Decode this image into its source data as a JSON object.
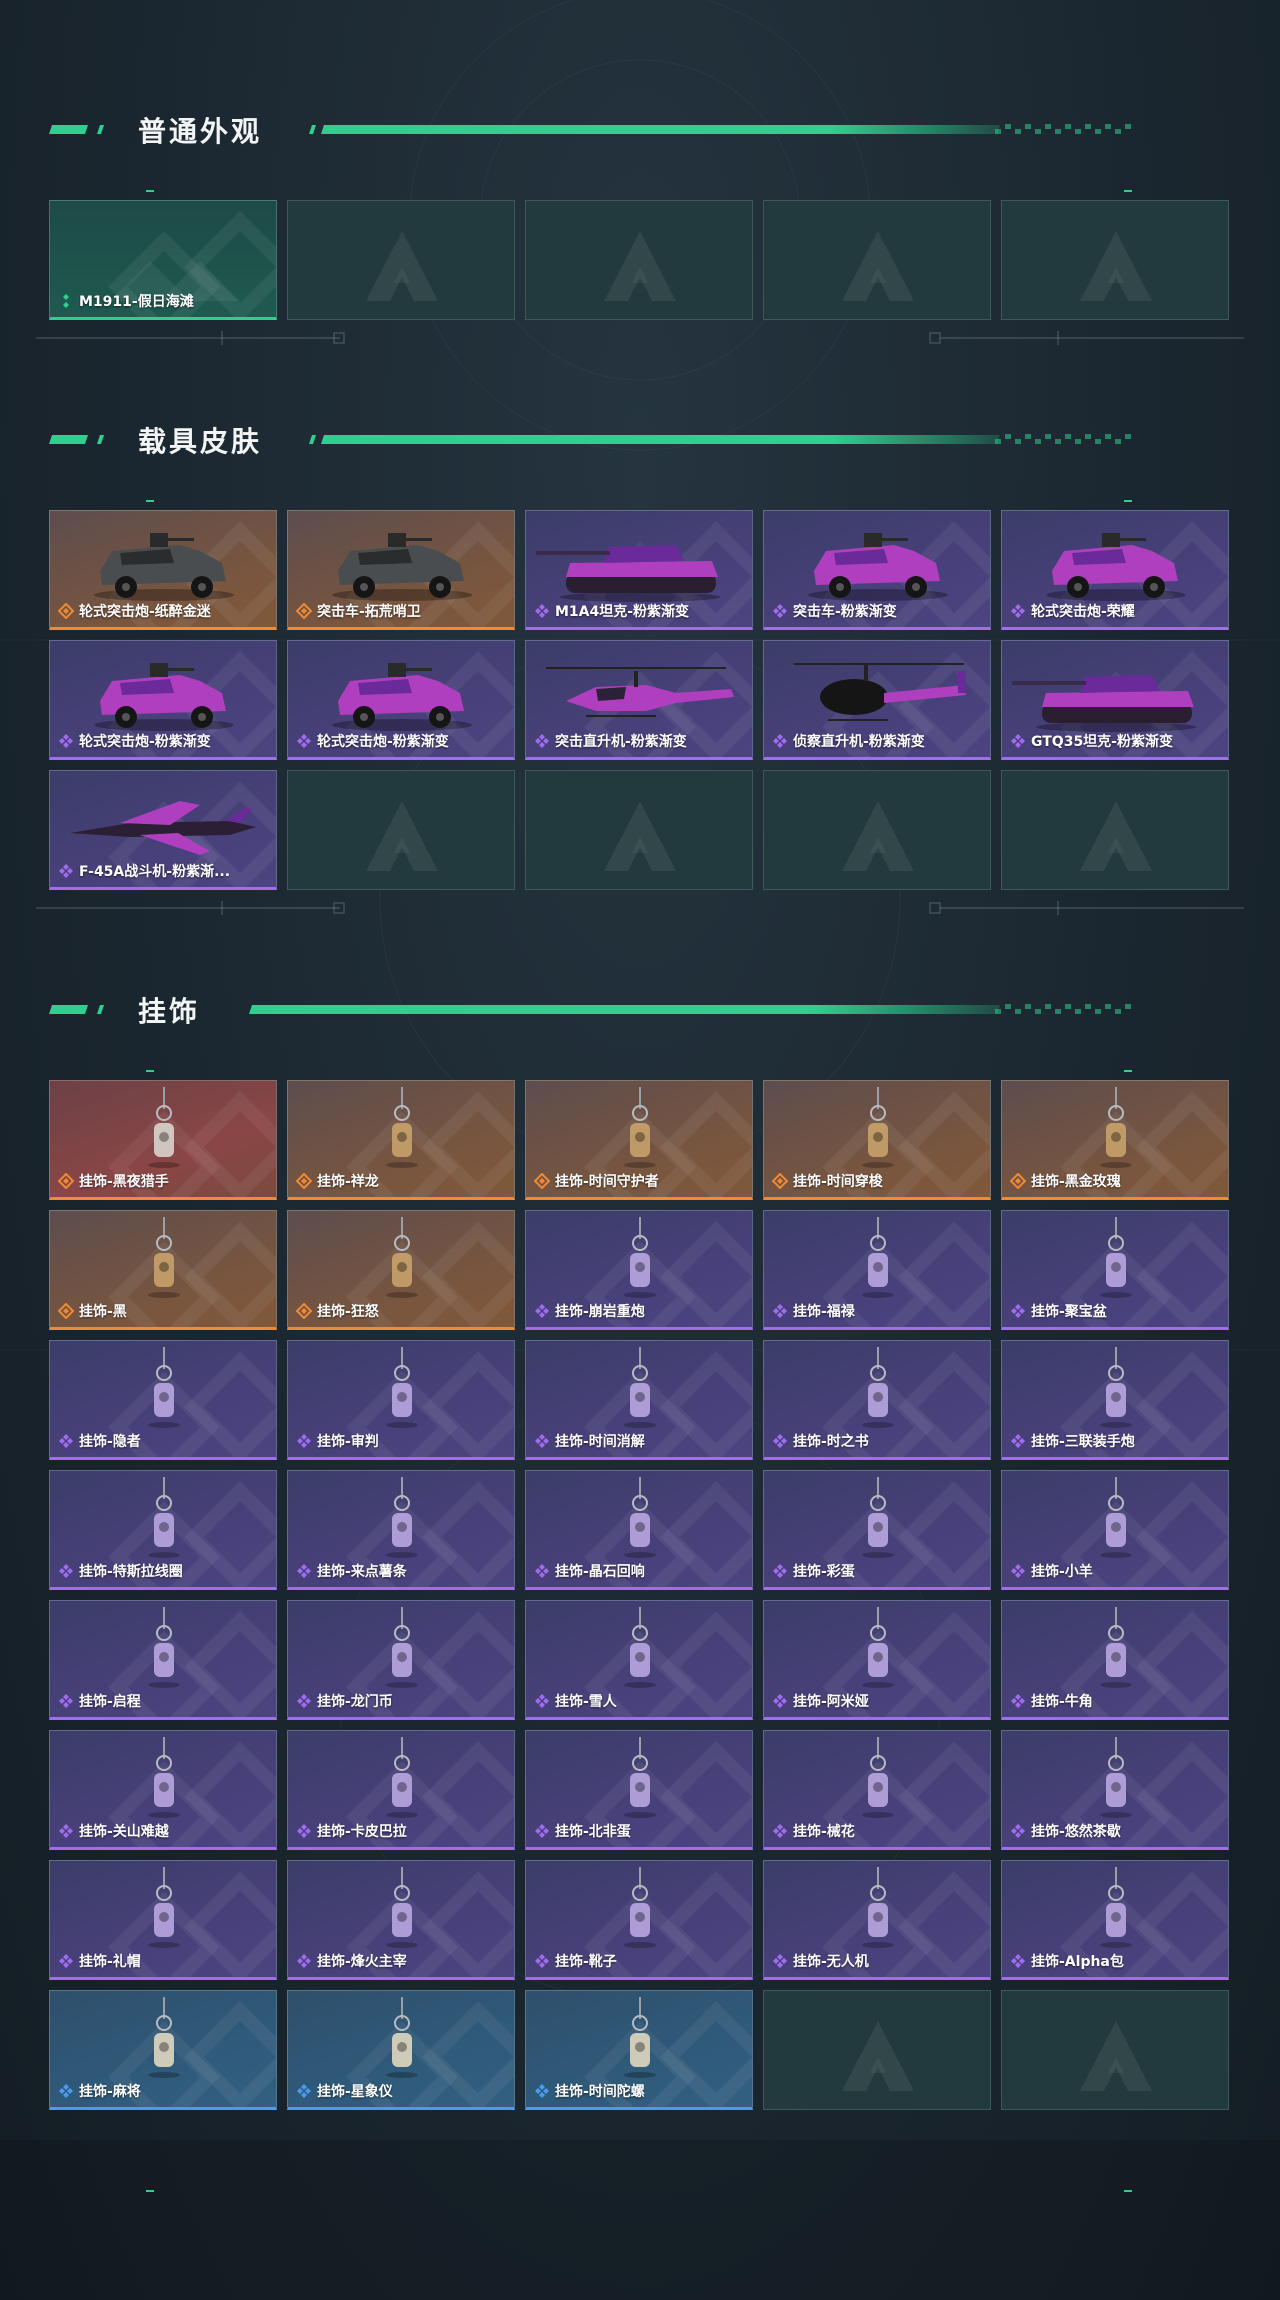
{
  "sections": [
    {
      "title": "普通外观",
      "items": [
        {
          "label": "M1911-假日海滩",
          "rarity": "green",
          "icon": "pistol-skin"
        },
        {
          "label": "",
          "rarity": "empty",
          "icon": "empty-slot"
        },
        {
          "label": "",
          "rarity": "empty",
          "icon": "empty-slot"
        },
        {
          "label": "",
          "rarity": "empty",
          "icon": "empty-slot"
        },
        {
          "label": "",
          "rarity": "empty",
          "icon": "empty-slot"
        }
      ]
    },
    {
      "title": "载具皮肤",
      "items": [
        {
          "label": "轮式突击炮-纸醉金迷",
          "rarity": "orange",
          "icon": "armored-car"
        },
        {
          "label": "突击车-拓荒哨卫",
          "rarity": "orange",
          "icon": "armored-car"
        },
        {
          "label": "M1A4坦克-粉紫渐变",
          "rarity": "purple",
          "icon": "tank"
        },
        {
          "label": "突击车-粉紫渐变",
          "rarity": "purple",
          "icon": "armored-car"
        },
        {
          "label": "轮式突击炮-荣耀",
          "rarity": "purple",
          "icon": "armored-car"
        },
        {
          "label": "轮式突击炮-粉紫渐变",
          "rarity": "purple",
          "icon": "armored-car"
        },
        {
          "label": "轮式突击炮-粉紫渐变",
          "rarity": "purple",
          "icon": "armored-car"
        },
        {
          "label": "突击直升机-粉紫渐变",
          "rarity": "purple",
          "icon": "attack-helicopter"
        },
        {
          "label": "侦察直升机-粉紫渐变",
          "rarity": "purple",
          "icon": "scout-helicopter"
        },
        {
          "label": "GTQ35坦克-粉紫渐变",
          "rarity": "purple",
          "icon": "tank"
        },
        {
          "label": "F-45A战斗机-粉紫渐...",
          "rarity": "purple",
          "icon": "fighter-jet"
        },
        {
          "label": "",
          "rarity": "empty",
          "icon": "empty-slot"
        },
        {
          "label": "",
          "rarity": "empty",
          "icon": "empty-slot"
        },
        {
          "label": "",
          "rarity": "empty",
          "icon": "empty-slot"
        },
        {
          "label": "",
          "rarity": "empty",
          "icon": "empty-slot"
        }
      ]
    },
    {
      "title": "挂饰",
      "items": [
        {
          "label": "挂饰-黑夜猎手",
          "rarity": "red",
          "icon": "charm"
        },
        {
          "label": "挂饰-祥龙",
          "rarity": "orange",
          "icon": "charm"
        },
        {
          "label": "挂饰-时间守护者",
          "rarity": "orange",
          "icon": "charm"
        },
        {
          "label": "挂饰-时间穿梭",
          "rarity": "orange",
          "icon": "charm"
        },
        {
          "label": "挂饰-黑金玫瑰",
          "rarity": "orange",
          "icon": "charm"
        },
        {
          "label": "挂饰-黑",
          "rarity": "orange",
          "icon": "charm"
        },
        {
          "label": "挂饰-狂怒",
          "rarity": "orange",
          "icon": "charm"
        },
        {
          "label": "挂饰-崩岩重炮",
          "rarity": "purple",
          "icon": "charm"
        },
        {
          "label": "挂饰-福禄",
          "rarity": "purple",
          "icon": "charm"
        },
        {
          "label": "挂饰-聚宝盆",
          "rarity": "purple",
          "icon": "charm"
        },
        {
          "label": "挂饰-隐者",
          "rarity": "purple",
          "icon": "charm"
        },
        {
          "label": "挂饰-审判",
          "rarity": "purple",
          "icon": "charm"
        },
        {
          "label": "挂饰-时间消解",
          "rarity": "purple",
          "icon": "charm"
        },
        {
          "label": "挂饰-时之书",
          "rarity": "purple",
          "icon": "charm"
        },
        {
          "label": "挂饰-三联装手炮",
          "rarity": "purple",
          "icon": "charm"
        },
        {
          "label": "挂饰-特斯拉线圈",
          "rarity": "purple",
          "icon": "charm"
        },
        {
          "label": "挂饰-来点薯条",
          "rarity": "purple",
          "icon": "charm"
        },
        {
          "label": "挂饰-晶石回响",
          "rarity": "purple",
          "icon": "charm"
        },
        {
          "label": "挂饰-彩蛋",
          "rarity": "purple",
          "icon": "charm"
        },
        {
          "label": "挂饰-小羊",
          "rarity": "purple",
          "icon": "charm"
        },
        {
          "label": "挂饰-启程",
          "rarity": "purple",
          "icon": "charm"
        },
        {
          "label": "挂饰-龙门币",
          "rarity": "purple",
          "icon": "charm"
        },
        {
          "label": "挂饰-雪人",
          "rarity": "purple",
          "icon": "charm"
        },
        {
          "label": "挂饰-阿米娅",
          "rarity": "purple",
          "icon": "charm"
        },
        {
          "label": "挂饰-牛角",
          "rarity": "purple",
          "icon": "charm"
        },
        {
          "label": "挂饰-关山难越",
          "rarity": "purple",
          "icon": "charm"
        },
        {
          "label": "挂饰-卡皮巴拉",
          "rarity": "purple",
          "icon": "charm"
        },
        {
          "label": "挂饰-北非蛋",
          "rarity": "purple",
          "icon": "charm"
        },
        {
          "label": "挂饰-械花",
          "rarity": "purple",
          "icon": "charm"
        },
        {
          "label": "挂饰-悠然茶歇",
          "rarity": "purple",
          "icon": "charm"
        },
        {
          "label": "挂饰-礼帽",
          "rarity": "purple",
          "icon": "charm"
        },
        {
          "label": "挂饰-烽火主宰",
          "rarity": "purple",
          "icon": "charm"
        },
        {
          "label": "挂饰-靴子",
          "rarity": "purple",
          "icon": "charm"
        },
        {
          "label": "挂饰-无人机",
          "rarity": "purple",
          "icon": "charm"
        },
        {
          "label": "挂饰-Alpha包",
          "rarity": "purple",
          "icon": "charm"
        },
        {
          "label": "挂饰-麻将",
          "rarity": "blue",
          "icon": "charm"
        },
        {
          "label": "挂饰-星象仪",
          "rarity": "blue",
          "icon": "charm"
        },
        {
          "label": "挂饰-时间陀螺",
          "rarity": "blue",
          "icon": "charm"
        },
        {
          "label": "",
          "rarity": "empty",
          "icon": "empty-slot"
        },
        {
          "label": "",
          "rarity": "empty",
          "icon": "empty-slot"
        }
      ]
    }
  ],
  "colors": {
    "accent": "#2fd08f",
    "rarity_orange": "#f08a33",
    "rarity_purple": "#a06cf0",
    "rarity_blue": "#4a9bf0",
    "rarity_green": "#2fd08f"
  }
}
